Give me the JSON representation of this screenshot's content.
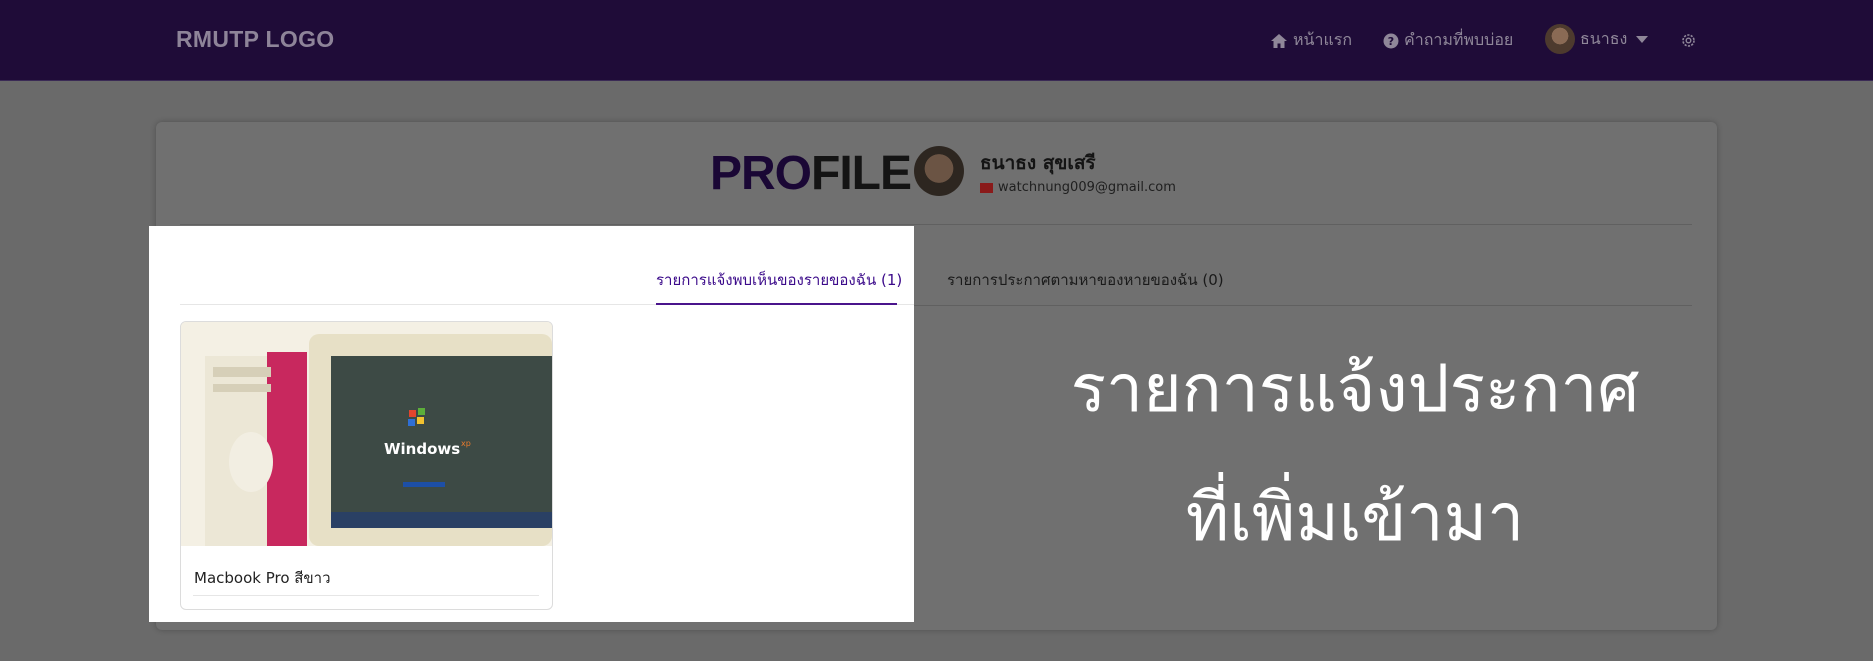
{
  "navbar": {
    "logo": "RMUTP LOGO",
    "home_label": "หน้าแรก",
    "faq_label": "คำถามที่พบบ่อย",
    "user_label": "ธนาธง"
  },
  "profile": {
    "title_part1": "PRO",
    "title_part2": "FILE",
    "name": "ธนาธง สุขเสรี",
    "email": "watchnung009@gmail.com"
  },
  "tabs": [
    {
      "label": "รายการแจ้งพบเห็นของรายของฉัน (1)",
      "active": true
    },
    {
      "label": "รายการประกาศตามหาของหายของฉัน (0)",
      "active": false
    }
  ],
  "items": [
    {
      "title": "Macbook Pro สีขาว"
    }
  ],
  "overlay": {
    "line1": "รายการแจ้งประกาศ",
    "line2": "ที่เพิ่มเข้ามา"
  },
  "colors": {
    "navbar": "#1f0c38",
    "accent": "#4a148c"
  }
}
